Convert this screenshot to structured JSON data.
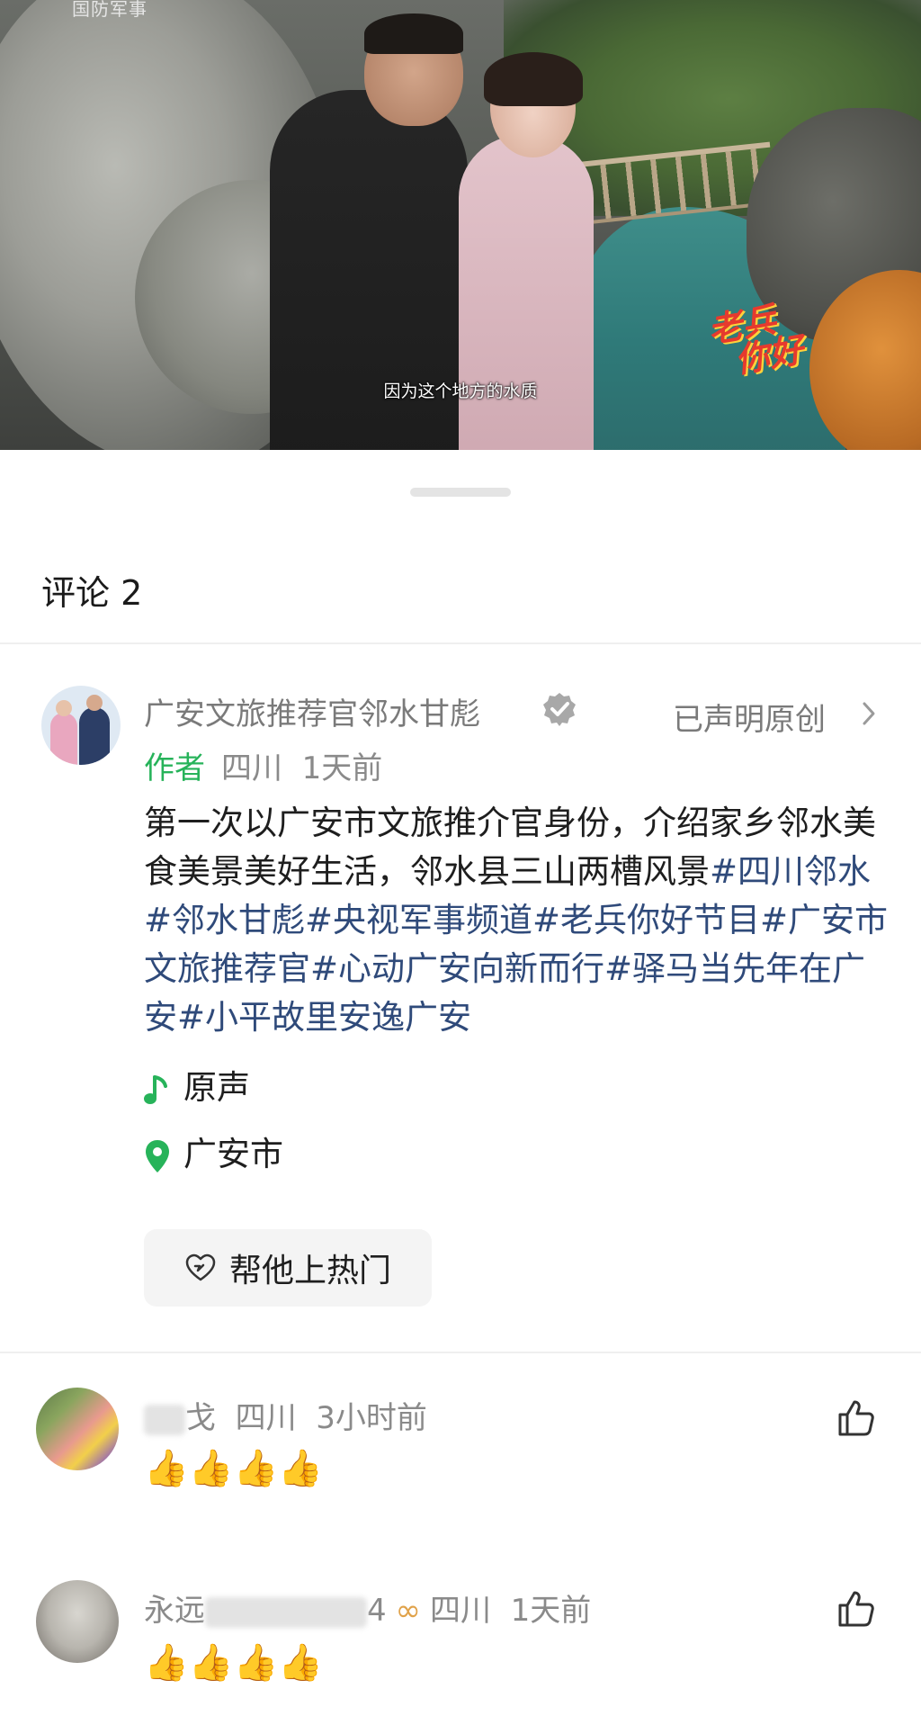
{
  "video": {
    "channel_logo": "国防军事",
    "subtitle": "因为这个地方的水质",
    "show_logo_line1": "老兵",
    "show_logo_line2": "你好"
  },
  "sheet": {
    "title": "评论 2"
  },
  "author_post": {
    "name": "广安文旅推荐官邻水甘彪",
    "verified_icon": "verified-badge-icon",
    "original_link": "已声明原创",
    "author_tag": "作者",
    "location": "四川",
    "time": "1天前",
    "text_plain": "第一次以广安市文旅推介官身份，介绍家乡邻水美食美景美好生活，邻水县三山两槽风景",
    "hashtags": [
      "#四川邻水",
      "#邻水甘彪",
      "#央视军事频道",
      "#老兵你好节目",
      "#广安市文旅推荐官",
      "#心动广安向新而行",
      "#驿马当先年在广安",
      "#小平故里安逸广安"
    ],
    "music": "原声",
    "place": "广安市",
    "boost_button": "帮他上热门"
  },
  "comments": [
    {
      "name_visible": "戈",
      "location": "四川",
      "time": "3小时前",
      "text": "👍👍👍👍"
    },
    {
      "name_visible_start": "永远",
      "name_visible_end": "4",
      "name_emoji": "∞",
      "location": "四川",
      "time": "1天前",
      "text": "👍👍👍👍"
    }
  ],
  "colors": {
    "author_tag": "#27b35a",
    "hashtag": "#2f4a7a",
    "meta_gray": "#8a8a8a"
  }
}
